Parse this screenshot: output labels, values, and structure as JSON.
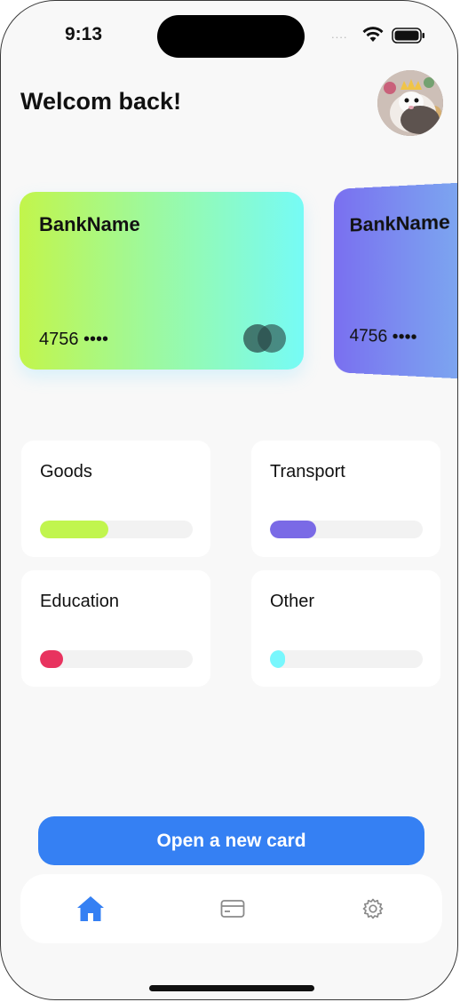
{
  "status_bar": {
    "time": "9:13",
    "signal_dots": "....",
    "wifi_icon": "wifi-icon",
    "battery_icon": "battery-icon"
  },
  "header": {
    "greeting": "Welcom back!",
    "avatar_icon": "avatar-photo"
  },
  "cards": [
    {
      "bank": "BankName",
      "number": "4756 ••••",
      "logo_icon": "mastercard-logo-icon",
      "gradient": [
        "#c2f54b",
        "#76fbf6"
      ]
    },
    {
      "bank": "BankName",
      "number": "4756 ••••",
      "gradient": [
        "#7a6ff0",
        "#7cb3f0"
      ]
    }
  ],
  "categories": [
    {
      "label": "Goods",
      "progress": 0.45,
      "color": "#c1f54e"
    },
    {
      "label": "Transport",
      "progress": 0.3,
      "color": "#7a6ae6"
    },
    {
      "label": "Education",
      "progress": 0.15,
      "color": "#e8335f"
    },
    {
      "label": "Other",
      "progress": 0.1,
      "color": "#78f7fd"
    }
  ],
  "actions": {
    "open_card_label": "Open a new card",
    "accent": "#3580f3"
  },
  "tabbar": {
    "items": [
      {
        "name": "home",
        "icon": "home-icon",
        "active": true
      },
      {
        "name": "cards",
        "icon": "card-icon",
        "active": false
      },
      {
        "name": "settings",
        "icon": "gear-icon",
        "active": false
      }
    ]
  }
}
